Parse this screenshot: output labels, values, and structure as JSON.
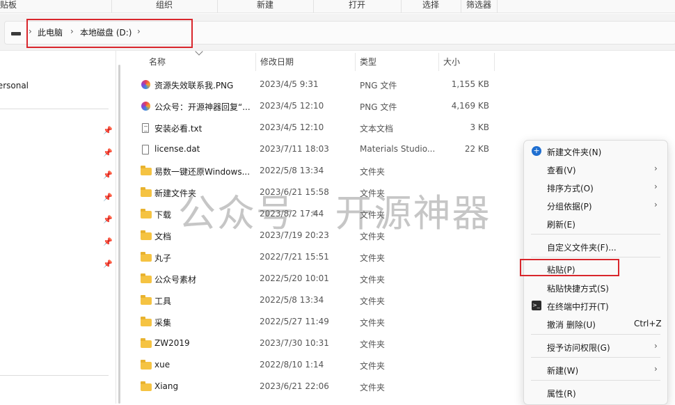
{
  "ribbon": {
    "groups": [
      "剪贴板",
      "组织",
      "新建",
      "打开",
      "选择",
      "筛选器"
    ]
  },
  "breadcrumb": {
    "items": [
      "此电脑",
      "本地磁盘 (D:)"
    ]
  },
  "nav": {
    "items": [
      "Personal"
    ]
  },
  "columns": {
    "name": "名称",
    "date": "修改日期",
    "type": "类型",
    "size": "大小"
  },
  "files": [
    {
      "name": "资源失效联系我.PNG",
      "date": "2023/4/5 9:31",
      "type": "PNG 文件",
      "size": "1,155 KB",
      "icon": "png-file-icon"
    },
    {
      "name": "公众号：开源神器回复“...",
      "date": "2023/4/5 12:10",
      "type": "PNG 文件",
      "size": "4,169 KB",
      "icon": "png-file-icon"
    },
    {
      "name": "安装必看.txt",
      "date": "2023/4/5 12:10",
      "type": "文本文档",
      "size": "3 KB",
      "icon": "text-file-icon"
    },
    {
      "name": "license.dat",
      "date": "2023/7/11 18:03",
      "type": "Materials Studio...",
      "size": "22 KB",
      "icon": "file-icon"
    },
    {
      "name": "易数一键还原Windows...",
      "date": "2022/5/8 13:34",
      "type": "文件夹",
      "size": "",
      "icon": "folder-icon"
    },
    {
      "name": "新建文件夹",
      "date": "2023/6/21 15:58",
      "type": "文件夹",
      "size": "",
      "icon": "folder-icon"
    },
    {
      "name": "下载",
      "date": "2023/8/2 17:44",
      "type": "文件夹",
      "size": "",
      "icon": "folder-icon"
    },
    {
      "name": "文档",
      "date": "2023/7/19 20:23",
      "type": "文件夹",
      "size": "",
      "icon": "folder-icon"
    },
    {
      "name": "丸子",
      "date": "2022/7/21 15:51",
      "type": "文件夹",
      "size": "",
      "icon": "folder-icon"
    },
    {
      "name": "公众号素材",
      "date": "2022/5/20 10:01",
      "type": "文件夹",
      "size": "",
      "icon": "folder-icon"
    },
    {
      "name": "工具",
      "date": "2022/5/8 13:34",
      "type": "文件夹",
      "size": "",
      "icon": "folder-icon"
    },
    {
      "name": "采集",
      "date": "2022/5/27 11:49",
      "type": "文件夹",
      "size": "",
      "icon": "folder-icon"
    },
    {
      "name": "ZW2019",
      "date": "2023/7/30 10:31",
      "type": "文件夹",
      "size": "",
      "icon": "folder-icon"
    },
    {
      "name": "xue",
      "date": "2022/8/10 1:14",
      "type": "文件夹",
      "size": "",
      "icon": "folder-icon"
    },
    {
      "name": "Xiang",
      "date": "2023/6/21 22:06",
      "type": "文件夹",
      "size": "",
      "icon": "folder-icon"
    }
  ],
  "watermark": "公众号 · 开源神器",
  "context_menu": {
    "new_folder": "新建文件夹(N)",
    "view": "查看(V)",
    "sort": "排序方式(O)",
    "group": "分组依据(P)",
    "refresh": "刷新(E)",
    "customize": "自定义文件夹(F)...",
    "paste": "粘贴(P)",
    "paste_shortcut": "粘贴快捷方式(S)",
    "open_terminal": "在终端中打开(T)",
    "undo_delete": "撤消 删除(U)",
    "undo_shortcut": "Ctrl+Z",
    "grant_access": "授予访问权限(G)",
    "new": "新建(W)",
    "properties": "属性(R)"
  },
  "colors": {
    "highlight_box": "#d9262c",
    "folder": "#f5c342"
  }
}
